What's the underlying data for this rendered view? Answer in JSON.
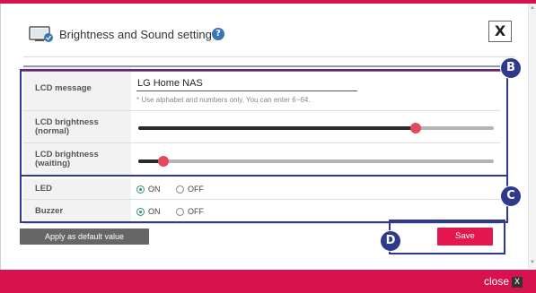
{
  "dialog": {
    "title": "Brightness and Sound setting",
    "help_icon": "?",
    "close_symbol": "X"
  },
  "settings": {
    "lcd_message": {
      "label": "LCD message",
      "value": "LG Home NAS",
      "hint": "* Use alphabet and numbers only, You can enter 6~64."
    },
    "lcd_brightness_normal": {
      "label_line1": "LCD brightness",
      "label_line2": "(normal)",
      "value_fraction": 0.78
    },
    "lcd_brightness_waiting": {
      "label_line1": "LCD brightness",
      "label_line2": "(waiting)",
      "value_fraction": 0.07
    },
    "led": {
      "label": "LED",
      "on_label": "ON",
      "off_label": "OFF",
      "selected": "ON"
    },
    "buzzer": {
      "label": "Buzzer",
      "on_label": "ON",
      "off_label": "OFF",
      "selected": "ON"
    }
  },
  "buttons": {
    "apply_default": "Apply as default value",
    "save": "Save"
  },
  "annotations": {
    "b": "B",
    "c": "C",
    "d": "D"
  },
  "footer": {
    "close_label": "close",
    "close_symbol": "X"
  },
  "colors": {
    "accent": "#d6124f",
    "save_button": "#e2174f",
    "annotation": "#2e3a8c",
    "slider_knob": "#e14a5d"
  },
  "icons": {
    "title": "monitor-icon",
    "help": "question-icon",
    "close": "close-icon"
  }
}
